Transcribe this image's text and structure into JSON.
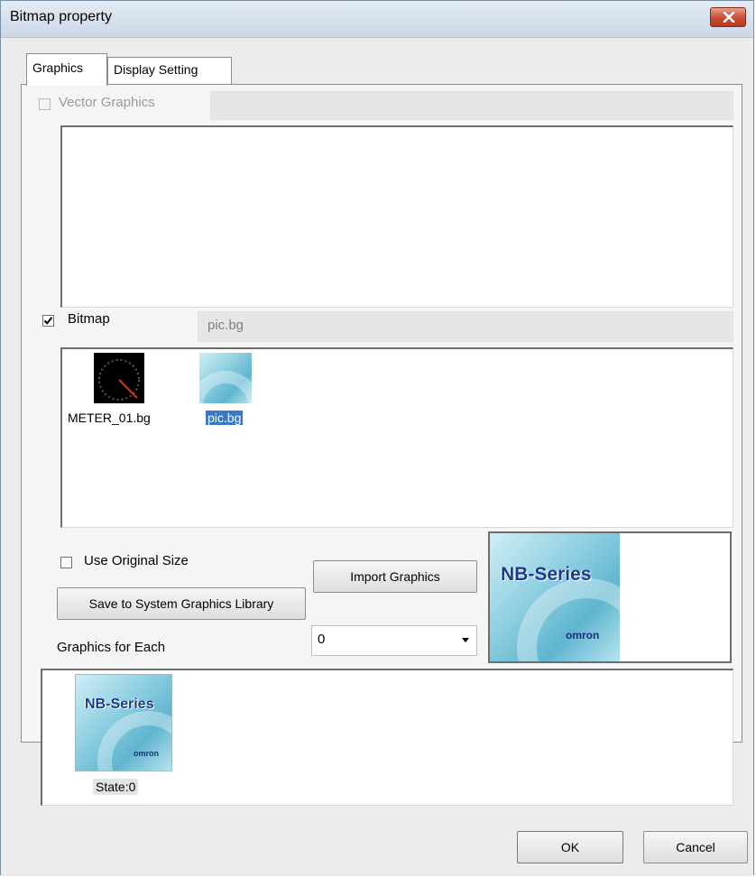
{
  "window": {
    "title": "Bitmap property"
  },
  "tabs": [
    {
      "label": "Graphics",
      "active": true
    },
    {
      "label": "Display Setting",
      "active": false
    }
  ],
  "vector_graphics": {
    "label": "Vector Graphics",
    "checked": false,
    "enabled": false,
    "field_value": ""
  },
  "bitmap": {
    "label": "Bitmap",
    "checked": true,
    "field_value": "pic.bg",
    "files": [
      {
        "name": "METER_01.bg",
        "selected": false
      },
      {
        "name": "pic.bg",
        "selected": true
      }
    ]
  },
  "options": {
    "use_original_size_label": "Use Original Size",
    "use_original_size_checked": false,
    "import_graphics_label": "Import Graphics",
    "save_to_library_label": "Save to System Graphics Library",
    "graphics_for_each_label": "Graphics for Each",
    "state_select_value": "0"
  },
  "preview": {
    "brand": "NB-Series",
    "maker": "omron"
  },
  "states": [
    {
      "label": "State:0"
    }
  ],
  "footer": {
    "ok_label": "OK",
    "cancel_label": "Cancel"
  },
  "colors": {
    "selection": "#3a78c8",
    "close_button": "#c94b33"
  }
}
